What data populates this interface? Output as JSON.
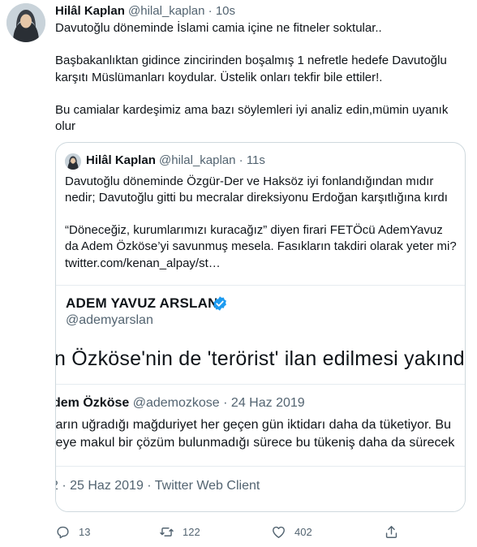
{
  "tweet": {
    "author_name": "Hilâl Kaplan",
    "author_handle": "@hilal_kaplan",
    "separator": "·",
    "time": "10s",
    "lines": [
      "Davutoğlu döneminde İslami camia içine ne fitneler soktular..",
      "",
      "Başbakanlıktan gidince zincirinden boşalmış 1 nefretle hedefe Davutoğlu",
      "karşıtı Müslümanları koydular. Üstelik onları tekfir bile ettiler!.",
      "",
      "Bu camialar kardeşimiz ama bazı söylemleri iyi analiz edin,mümin uyanık",
      "olur"
    ]
  },
  "quoted": {
    "author_name": "Hilâl Kaplan",
    "author_handle": "@hilal_kaplan",
    "separator": "·",
    "time": "11s",
    "lines": [
      "Davutoğlu döneminde Özgür-Der ve Haksöz iyi fonlandığından mıdır",
      "nedir; Davutoğlu gitti bu mecralar direksiyonu Erdoğan karşıtlığına kırdı",
      "",
      "“Döneceğiz, kurumlarımızı kuracağız” diyen firari FETÖcü AdemYavuz",
      "da Adem Özköse’yi savunmuş mesela. Fasıkların takdiri olarak yeter mi?",
      "twitter.com/kenan_alpay/st…"
    ],
    "screenshot": {
      "name": "ADEM YAVUZ ARSLAN",
      "handle": "@ademyarslan",
      "headline": "n Özköse'nin de 'terörist' ilan edilmesi yakınd",
      "inner_name": "dem Özköse",
      "inner_handle": "@ademozkose",
      "inner_separator": "·",
      "inner_date": "24 Haz 2019",
      "inner_lines": [
        "ların uğradığı mağduriyet her geçen gün iktidarı daha da tüketiyor. Bu",
        "leye makul bir çözüm bulunmadığı sürece bu tükeniş daha da sürecek"
      ],
      "footer": "2 · 25 Haz 2019 · Twitter Web Client"
    }
  },
  "actions": {
    "replies": "13",
    "retweets": "122",
    "likes": "402"
  },
  "colors": {
    "text": "#0f1419",
    "muted": "#536471",
    "border": "#cfd9de",
    "verified": "#1d9bf0"
  }
}
